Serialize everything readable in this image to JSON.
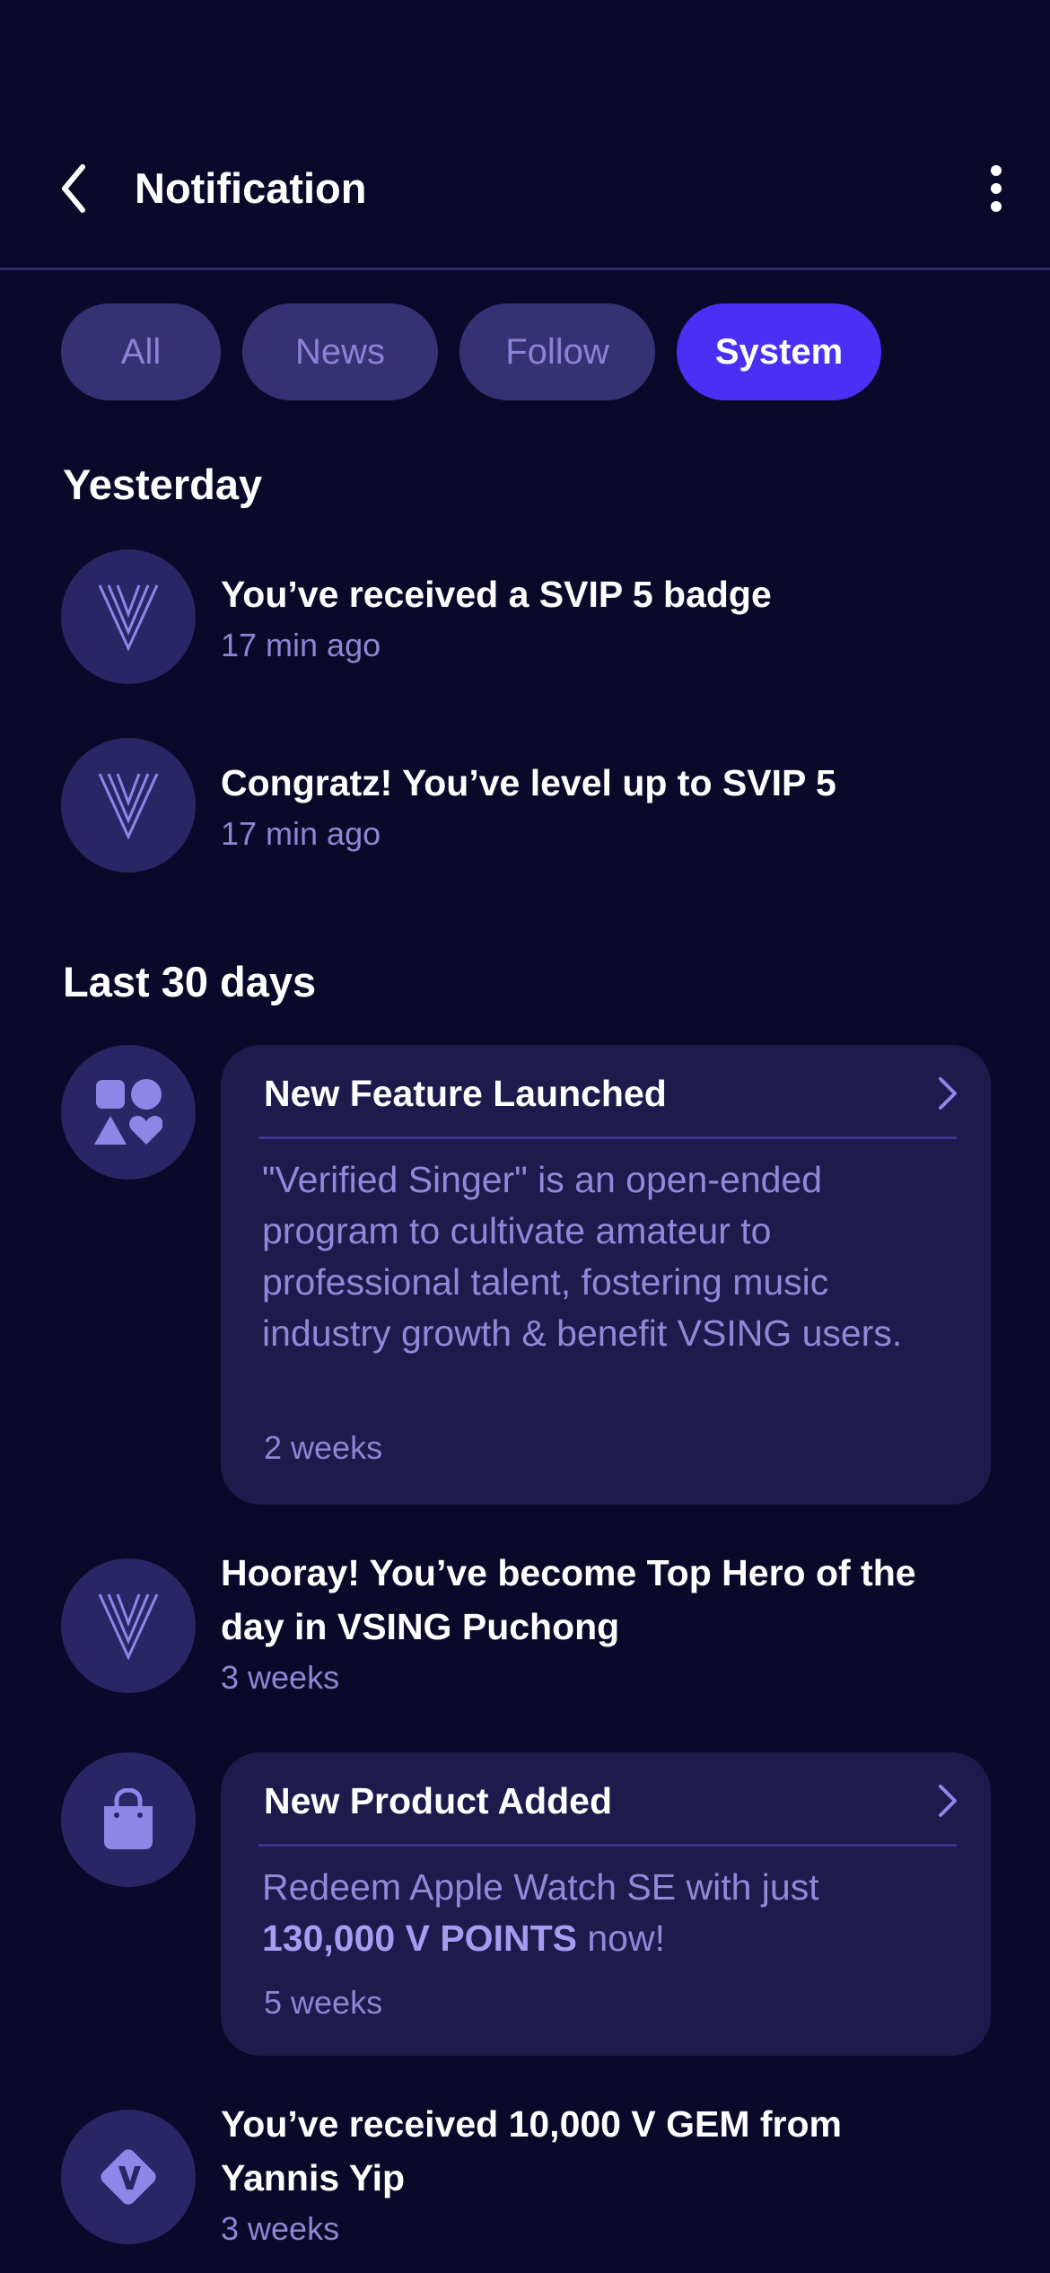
{
  "header": {
    "title": "Notification",
    "back_icon": "chevron-left-icon",
    "more_icon": "more-vertical-icon"
  },
  "tabs": [
    {
      "label": "All",
      "active": false
    },
    {
      "label": "News",
      "active": false
    },
    {
      "label": "Follow",
      "active": false
    },
    {
      "label": "System",
      "active": true
    }
  ],
  "sections": {
    "yesterday": {
      "title": "Yesterday",
      "items": [
        {
          "icon": "vsing-logo-icon",
          "title": "You’ve received a SVIP 5 badge",
          "time": "17 min ago"
        },
        {
          "icon": "vsing-logo-icon",
          "title": "Congratz! You’ve level up to SVIP 5",
          "time": "17 min ago"
        }
      ]
    },
    "last30": {
      "title": "Last 30 days",
      "feature_card": {
        "icon": "shapes-icon",
        "title": "New Feature Launched",
        "body": "\"Verified Singer\" is an open-ended program to cultivate amateur to professional talent, fostering music industry growth & benefit VSING users.",
        "time": "2 weeks"
      },
      "hero_item": {
        "icon": "vsing-logo-icon",
        "title": "Hooray! You’ve become Top Hero of the day in VSING Puchong",
        "time": "3 weeks"
      },
      "product_card": {
        "icon": "shopping-bag-icon",
        "title": "New Product Added",
        "body_prefix": "Redeem Apple Watch SE with just",
        "body_highlight": "130,000 V POINTS",
        "body_suffix": "now!",
        "time": "5 weeks"
      },
      "gem_item": {
        "icon": "v-gem-icon",
        "title": "You’ve received 10,000 V GEM from Yannis Yip",
        "time": "3 weeks"
      }
    }
  },
  "colors": {
    "background": "#0b0929",
    "accent": "#4b2ff5",
    "tab_inactive": "#363173",
    "card": "#1e1a4c",
    "muted_text": "#8d86d4",
    "icon": "#8f86e8"
  }
}
